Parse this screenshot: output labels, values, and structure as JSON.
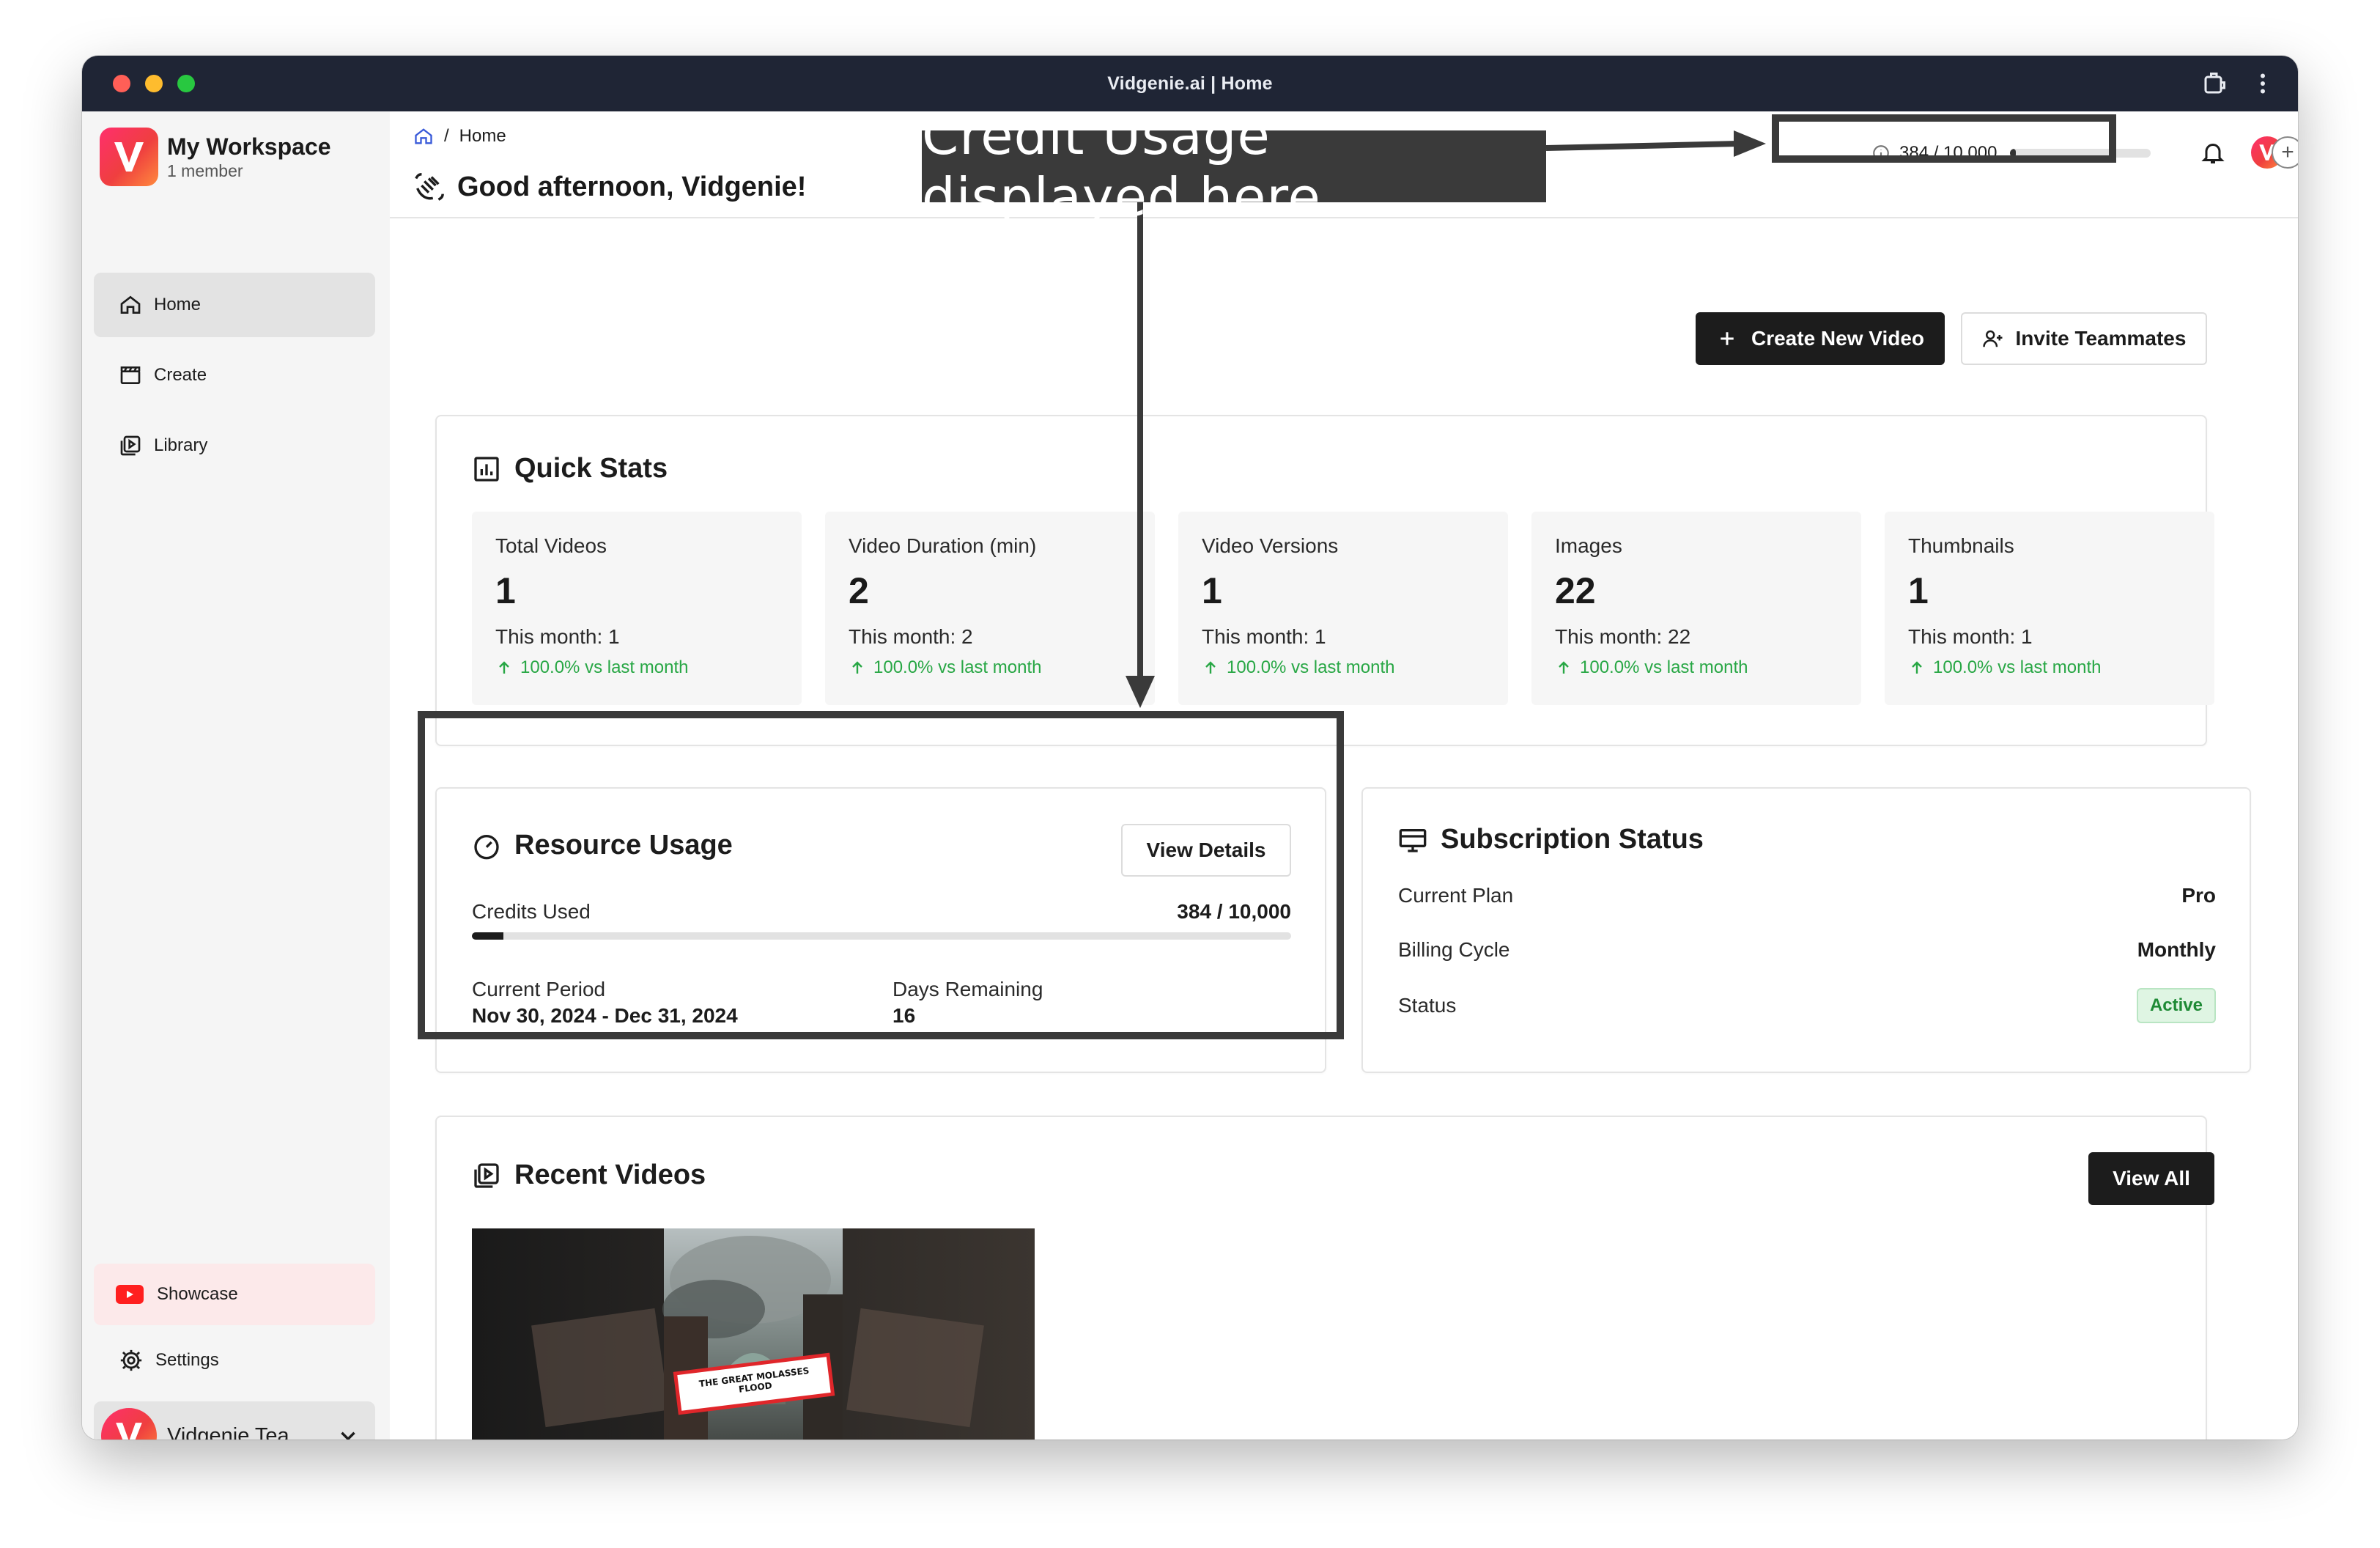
{
  "window": {
    "title": "Vidgenie.ai | Home"
  },
  "sidebar": {
    "workspace_name": "My Workspace",
    "workspace_members": "1 member",
    "nav": [
      {
        "label": "Home",
        "icon": "home-icon",
        "active": true
      },
      {
        "label": "Create",
        "icon": "clapperboard-icon",
        "active": false
      },
      {
        "label": "Library",
        "icon": "library-icon",
        "active": false
      }
    ],
    "showcase_label": "Showcase",
    "settings_label": "Settings",
    "team_name": "Vidgenie Tea..."
  },
  "header": {
    "breadcrumb_sep": "/",
    "breadcrumb_current": "Home",
    "greeting": "Good afternoon, Vidgenie!",
    "credits_text": "384 / 10,000",
    "credits_fraction": 0.0384
  },
  "actions": {
    "create_video": "Create New Video",
    "invite": "Invite Teammates"
  },
  "quick_stats": {
    "title": "Quick Stats",
    "items": [
      {
        "label": "Total Videos",
        "value": "1",
        "month": "This month: 1",
        "delta": "100.0% vs last month"
      },
      {
        "label": "Video Duration (min)",
        "value": "2",
        "month": "This month: 2",
        "delta": "100.0% vs last month"
      },
      {
        "label": "Video Versions",
        "value": "1",
        "month": "This month: 1",
        "delta": "100.0% vs last month"
      },
      {
        "label": "Images",
        "value": "22",
        "month": "This month: 22",
        "delta": "100.0% vs last month"
      },
      {
        "label": "Thumbnails",
        "value": "1",
        "month": "This month: 1",
        "delta": "100.0% vs last month"
      }
    ]
  },
  "resource_usage": {
    "title": "Resource Usage",
    "view_details": "View Details",
    "credits_label": "Credits Used",
    "credits_value": "384 / 10,000",
    "credits_fraction": 0.0384,
    "period_label": "Current Period",
    "period_value": "Nov 30, 2024 - Dec 31, 2024",
    "days_label": "Days Remaining",
    "days_value": "16"
  },
  "subscription": {
    "title": "Subscription Status",
    "plan_label": "Current Plan",
    "plan_value": "Pro",
    "cycle_label": "Billing Cycle",
    "cycle_value": "Monthly",
    "status_label": "Status",
    "status_value": "Active"
  },
  "recent_videos": {
    "title": "Recent Videos",
    "view_all": "View All",
    "thumb_caption": "THE GREAT MOLASSES FLOOD"
  },
  "annotation": {
    "label": "Credit Usage displayed here"
  },
  "colors": {
    "titlebar": "#1f2535",
    "accent_dark": "#1c1c1c",
    "positive": "#28a745",
    "brand_gradient_start": "#ff2f6d",
    "brand_gradient_end": "#ff8a3d",
    "annotation": "#3a3a3a"
  }
}
